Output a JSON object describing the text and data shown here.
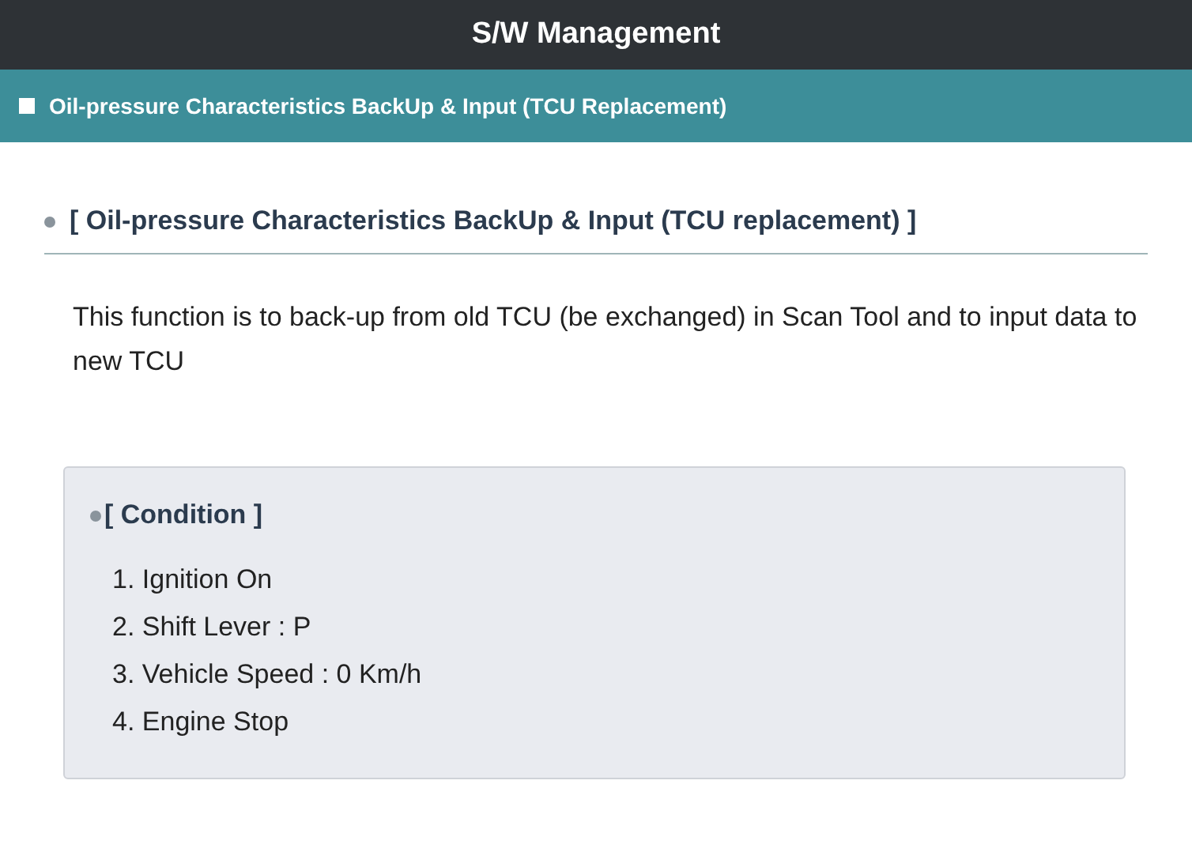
{
  "window": {
    "title": "S/W Management"
  },
  "section_bar": {
    "title": "Oil-pressure Characteristics BackUp & Input (TCU Replacement)"
  },
  "heading": "[ Oil-pressure Characteristics BackUp & Input (TCU replacement) ]",
  "description": "This function is to back-up from old TCU (be exchanged) in Scan Tool and to input data to new TCU",
  "condition": {
    "title": "[ Condition ]",
    "items": [
      "1. Ignition On",
      "2. Shift Lever : P",
      "3. Vehicle Speed : 0 Km/h",
      "4. Engine Stop"
    ]
  }
}
